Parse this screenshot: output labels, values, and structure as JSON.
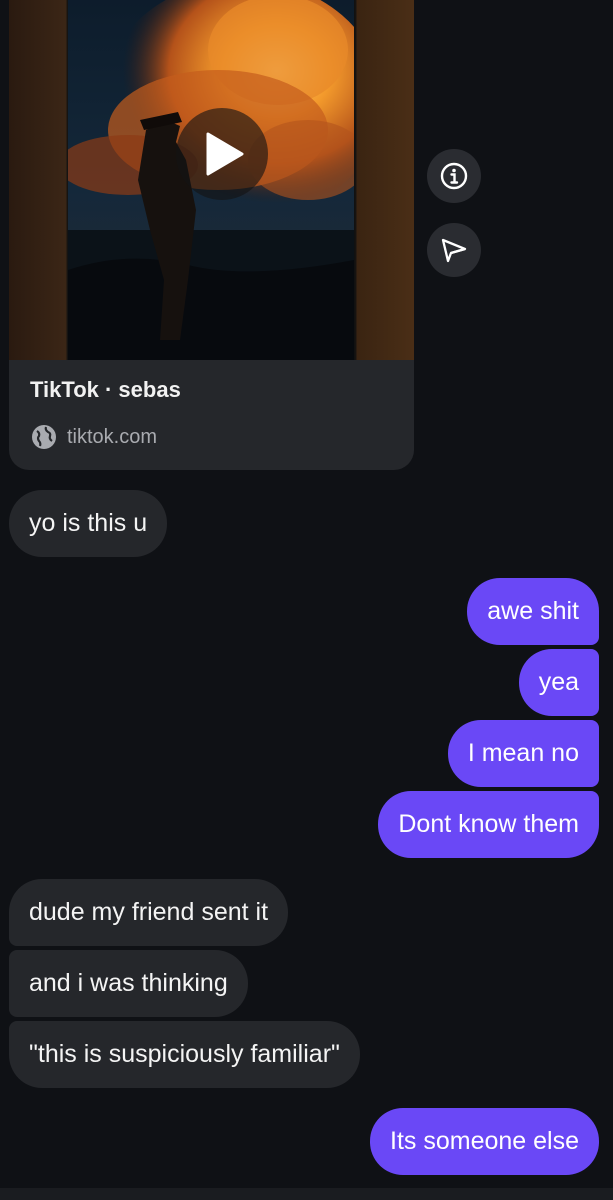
{
  "link_preview": {
    "title": "TikTok · sebas",
    "domain": "tiktok.com",
    "play_icon": "play-icon",
    "globe_icon": "globe-icon"
  },
  "side_actions": {
    "info_icon": "info-icon",
    "share_icon": "send-icon"
  },
  "messages": [
    {
      "from": "them",
      "text": "yo is this u"
    },
    {
      "from": "me",
      "text": "awe shit"
    },
    {
      "from": "me",
      "text": "yea"
    },
    {
      "from": "me",
      "text": "I mean no"
    },
    {
      "from": "me",
      "text": "Dont know them"
    },
    {
      "from": "them",
      "text": "dude my friend sent it"
    },
    {
      "from": "them",
      "text": "and i was thinking"
    },
    {
      "from": "them",
      "text": "\"this is suspiciously familiar\""
    },
    {
      "from": "me",
      "text": "Its someone else"
    }
  ],
  "colors": {
    "background": "#0f1115",
    "incoming_bubble": "#25272b",
    "outgoing_bubble": "#6a48f6"
  }
}
